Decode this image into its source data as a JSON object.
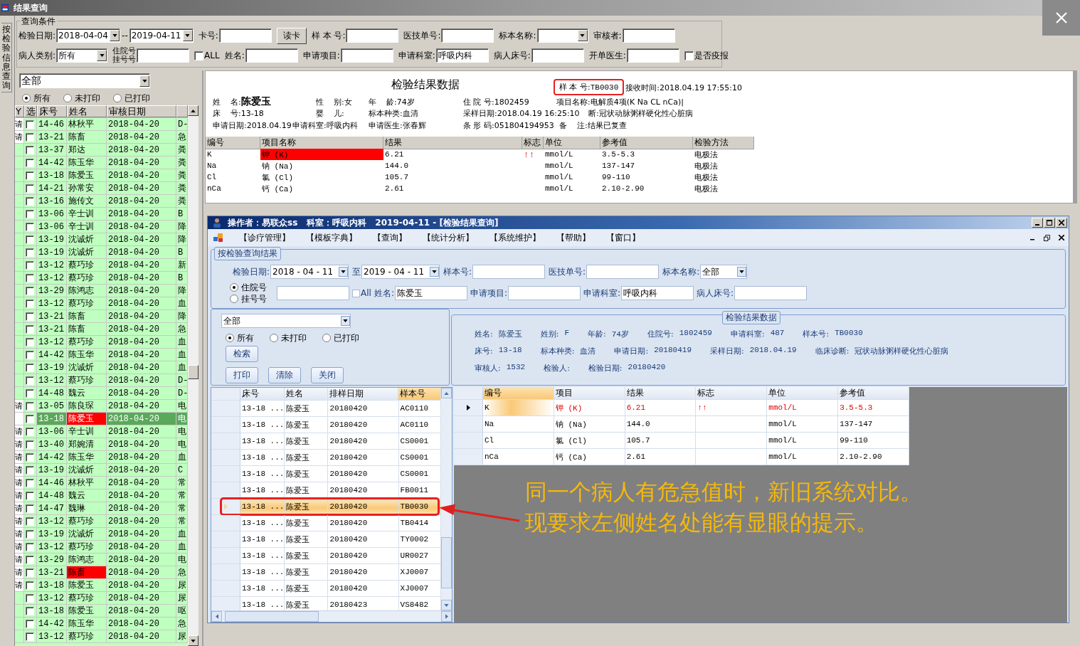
{
  "window": {
    "title": "结果查询"
  },
  "side_tab": {
    "label": "按检验信息查询"
  },
  "query": {
    "title": "查询条件",
    "lines": [
      {
        "fields": [
          {
            "kind": "date",
            "label": "检验日期:",
            "value": "2018-04-04"
          },
          {
            "kind": "separator",
            "text": "--"
          },
          {
            "kind": "date",
            "value": "2019-04-11"
          },
          {
            "kind": "text",
            "label": "卡号:"
          },
          {
            "kind": "button",
            "label": "读卡"
          },
          {
            "kind": "text",
            "label": "样 本 号:"
          },
          {
            "kind": "text",
            "label": "医技单号:"
          },
          {
            "kind": "combo",
            "label": "标本名称:"
          },
          {
            "kind": "text",
            "label": "审核者:"
          }
        ]
      },
      {
        "fields": [
          {
            "kind": "combo",
            "label": "病人类别:",
            "value": "所有"
          },
          {
            "kind": "stacked-text",
            "label_lines": [
              "住院号",
              "挂号号"
            ]
          },
          {
            "kind": "check",
            "label": "ALL",
            "checked": false
          },
          {
            "kind": "text",
            "label": "姓名:"
          },
          {
            "kind": "text",
            "label": "申请项目:"
          },
          {
            "kind": "text",
            "label": "申请科室:",
            "value": "呼吸内科"
          },
          {
            "kind": "text",
            "label": "病人床号:"
          },
          {
            "kind": "text",
            "label": "开单医生:"
          },
          {
            "kind": "check",
            "label": "是否疫报",
            "checked": false
          }
        ]
      }
    ]
  },
  "filter": {
    "category": "全部",
    "radios": [
      {
        "label": "所有",
        "selected": true
      },
      {
        "label": "未打印",
        "selected": false
      },
      {
        "label": "已打印",
        "selected": false
      }
    ]
  },
  "patients": {
    "columns": [
      "Y",
      "选",
      "床号",
      "姓名",
      "审核日期"
    ],
    "rows": [
      {
        "flag": "请",
        "checked": false,
        "bed": "14-46",
        "name": "林秋平",
        "date": "2018-04-20",
        "column_6": "D-",
        "selected": false,
        "alert": false
      },
      {
        "flag": "请",
        "checked": false,
        "bed": "13-21",
        "name": "陈畜",
        "date": "2018-04-20",
        "column_6": "急",
        "selected": false,
        "alert": false
      },
      {
        "checked": false,
        "bed": "13-37",
        "name": "郑达",
        "date": "2018-04-20",
        "column_6": "粪",
        "selected": false,
        "alert": false
      },
      {
        "checked": false,
        "bed": "14-42",
        "name": "陈玉华",
        "date": "2018-04-20",
        "column_6": "粪",
        "selected": false,
        "alert": false
      },
      {
        "checked": false,
        "bed": "13-18",
        "name": "陈爱玉",
        "date": "2018-04-20",
        "column_6": "粪",
        "selected": false,
        "alert": false
      },
      {
        "checked": false,
        "bed": "14-21",
        "name": "孙常安",
        "date": "2018-04-20",
        "column_6": "粪",
        "selected": false,
        "alert": false
      },
      {
        "checked": false,
        "bed": "13-16",
        "name": "施传文",
        "date": "2018-04-20",
        "column_6": "粪",
        "selected": false,
        "alert": false
      },
      {
        "checked": false,
        "bed": "13-06",
        "name": "辛士训",
        "date": "2018-04-20",
        "column_6": "B",
        "selected": false,
        "alert": false
      },
      {
        "checked": false,
        "bed": "13-06",
        "name": "辛士训",
        "date": "2018-04-20",
        "column_6": "降",
        "selected": false,
        "alert": false
      },
      {
        "checked": false,
        "bed": "13-19",
        "name": "沈诚炘",
        "date": "2018-04-20",
        "column_6": "降",
        "selected": false,
        "alert": false
      },
      {
        "checked": false,
        "bed": "13-19",
        "name": "沈诚炘",
        "date": "2018-04-20",
        "column_6": "B",
        "selected": false,
        "alert": false
      },
      {
        "checked": false,
        "bed": "13-12",
        "name": "蔡巧珍",
        "date": "2018-04-20",
        "column_6": "新",
        "selected": false,
        "alert": false
      },
      {
        "checked": false,
        "bed": "13-12",
        "name": "蔡巧珍",
        "date": "2018-04-20",
        "column_6": "B",
        "selected": false,
        "alert": false
      },
      {
        "checked": false,
        "bed": "13-29",
        "name": "陈鸿志",
        "date": "2018-04-20",
        "column_6": "降",
        "selected": false,
        "alert": false
      },
      {
        "checked": false,
        "bed": "13-12",
        "name": "蔡巧珍",
        "date": "2018-04-20",
        "column_6": "血",
        "selected": false,
        "alert": false
      },
      {
        "checked": false,
        "bed": "13-21",
        "name": "陈畜",
        "date": "2018-04-20",
        "column_6": "降",
        "selected": false,
        "alert": false
      },
      {
        "checked": false,
        "bed": "13-21",
        "name": "陈畜",
        "date": "2018-04-20",
        "column_6": "急",
        "selected": false,
        "alert": false
      },
      {
        "checked": false,
        "bed": "13-12",
        "name": "蔡巧珍",
        "date": "2018-04-20",
        "column_6": "血",
        "selected": false,
        "alert": false
      },
      {
        "checked": false,
        "bed": "14-42",
        "name": "陈玉华",
        "date": "2018-04-20",
        "column_6": "血",
        "selected": false,
        "alert": false
      },
      {
        "checked": false,
        "bed": "13-19",
        "name": "沈诚炘",
        "date": "2018-04-20",
        "column_6": "血",
        "selected": false,
        "alert": false
      },
      {
        "checked": false,
        "bed": "13-12",
        "name": "蔡巧珍",
        "date": "2018-04-20",
        "column_6": "D-",
        "selected": false,
        "alert": false
      },
      {
        "checked": false,
        "bed": "14-48",
        "name": "魏云",
        "date": "2018-04-20",
        "column_6": "D-",
        "selected": false,
        "alert": false
      },
      {
        "flag": "请",
        "checked": false,
        "bed": "13-05",
        "name": "陈良琛",
        "date": "2018-04-20",
        "column_6": "电",
        "selected": false,
        "alert": false
      },
      {
        "checked": false,
        "bed": "13-18",
        "name": "陈爱玉",
        "date": "2018-04-20",
        "column_6": "电",
        "selected": true,
        "alert": true
      },
      {
        "flag": "请",
        "checked": false,
        "bed": "13-06",
        "name": "辛士训",
        "date": "2018-04-20",
        "column_6": "电",
        "selected": false,
        "alert": false
      },
      {
        "flag": "请",
        "checked": false,
        "bed": "13-40",
        "name": "郑婉清",
        "date": "2018-04-20",
        "column_6": "电",
        "selected": false,
        "alert": false
      },
      {
        "flag": "请",
        "checked": false,
        "bed": "14-42",
        "name": "陈玉华",
        "date": "2018-04-20",
        "column_6": "血",
        "selected": false,
        "alert": false
      },
      {
        "flag": "请",
        "checked": false,
        "bed": "13-19",
        "name": "沈诚炘",
        "date": "2018-04-20",
        "column_6": "C",
        "selected": false,
        "alert": false
      },
      {
        "flag": "请",
        "checked": false,
        "bed": "14-46",
        "name": "林秋平",
        "date": "2018-04-20",
        "column_6": "常",
        "selected": false,
        "alert": false
      },
      {
        "flag": "请",
        "checked": false,
        "bed": "14-48",
        "name": "魏云",
        "date": "2018-04-20",
        "column_6": "常",
        "selected": false,
        "alert": false
      },
      {
        "flag": "请",
        "checked": false,
        "bed": "14-47",
        "name": "魏琳",
        "date": "2018-04-20",
        "column_6": "常",
        "selected": false,
        "alert": false
      },
      {
        "flag": "请",
        "checked": false,
        "bed": "13-12",
        "name": "蔡巧珍",
        "date": "2018-04-20",
        "column_6": "常",
        "selected": false,
        "alert": false
      },
      {
        "flag": "请",
        "checked": false,
        "bed": "13-19",
        "name": "沈诚炘",
        "date": "2018-04-20",
        "column_6": "血",
        "selected": false,
        "alert": false
      },
      {
        "flag": "请",
        "checked": false,
        "bed": "13-12",
        "name": "蔡巧珍",
        "date": "2018-04-20",
        "column_6": "血",
        "selected": false,
        "alert": false
      },
      {
        "flag": "请",
        "checked": false,
        "bed": "13-29",
        "name": "陈鸿志",
        "date": "2018-04-20",
        "column_6": "电",
        "selected": false,
        "alert": false
      },
      {
        "flag": "请",
        "checked": false,
        "bed": "13-21",
        "name": "陈畜",
        "date": "2018-04-20",
        "column_6": "急",
        "selected": false,
        "alert": true
      },
      {
        "flag": "请",
        "checked": false,
        "bed": "13-18",
        "name": "陈爱玉",
        "date": "2018-04-20",
        "column_6": "尿",
        "selected": false,
        "alert": false
      },
      {
        "checked": false,
        "bed": "13-12",
        "name": "蔡巧珍",
        "date": "2018-04-20",
        "column_6": "尿",
        "selected": false,
        "alert": false
      },
      {
        "checked": false,
        "bed": "13-18",
        "name": "陈爱玉",
        "date": "2018-04-20",
        "column_6": "呕",
        "selected": false,
        "alert": false
      },
      {
        "checked": false,
        "bed": "14-42",
        "name": "陈玉华",
        "date": "2018-04-20",
        "column_6": "急",
        "selected": false,
        "alert": false
      },
      {
        "checked": false,
        "bed": "13-12",
        "name": "蔡巧珍",
        "date": "2018-04-20",
        "column_6": "尿",
        "selected": false,
        "alert": false
      }
    ]
  },
  "report": {
    "title": "检验结果数据",
    "sample": {
      "label": "样 本 号:",
      "value": "TB0030",
      "circled": true
    },
    "received": "接收时间:2018.04.19 17:55:10",
    "lines": [
      [
        {
          "label": "姓    名:",
          "value": "陈爱玉",
          "bold": true
        },
        {
          "label": "性    别:",
          "value": "女"
        },
        {
          "label": "年    龄:",
          "value": "74岁"
        },
        {
          "label": "住 院 号:",
          "value": "1802459"
        },
        {
          "label": "项目名称:",
          "value": "电解质4项(K Na CL nCa)|"
        }
      ],
      [
        {
          "label": "床    号:",
          "value": "13-18"
        },
        {
          "label": "婴    儿:"
        },
        {
          "label": "标本种类:",
          "value": "血清"
        },
        {
          "label": "采样日期:",
          "value": "2018.04.19 16:25:10"
        },
        {
          "label": "断:",
          "value": "冠状动脉粥样硬化性心脏病"
        }
      ],
      [
        {
          "label": "申请日期:",
          "value": "2018.04.19"
        },
        {
          "label": "申请科室:",
          "value": "呼吸内科"
        },
        {
          "label": "申请医生:",
          "value": "张春辉"
        },
        {
          "label": "条 形 码:",
          "value": "051804194953"
        },
        {
          "label": "备    注:",
          "value": "结果已复查"
        }
      ]
    ],
    "columns": [
      "编号",
      "项目名称",
      "结果",
      "标志",
      "单位",
      "参考值",
      "检验方法"
    ],
    "rows": [
      {
        "code": "K",
        "name": "钾 (K)",
        "result": "6.21",
        "flag": "↑↑",
        "unit": "mmol/L",
        "range": "3.5-5.3",
        "method": "电极法",
        "alert": true
      },
      {
        "code": "Na",
        "name": "钠 (Na)",
        "result": "144.0",
        "unit": "mmol/L",
        "range": "137-147",
        "method": "电极法",
        "alert": false
      },
      {
        "code": "Cl",
        "name": "氯 (Cl)",
        "result": "105.7",
        "unit": "mmol/L",
        "range": "99-110",
        "method": "电极法",
        "alert": false
      },
      {
        "code": "nCa",
        "name": "钙 (Ca)",
        "result": "2.61",
        "unit": "mmol/L",
        "range": "2.10-2.90",
        "method": "电极法",
        "alert": false
      }
    ]
  },
  "inner_window": {
    "title": "操作者：易联众ss   科室：呼吸内科   2019-04-11 - [检验结果查询]",
    "menu": [
      "【诊疗管理】",
      "【模板字典】",
      "【查询】",
      "【统计分析】",
      "【系统维护】",
      "【帮助】",
      "【窗口】"
    ],
    "query": {
      "title": "按检验查询结果",
      "lines": [
        {
          "fields": [
            {
              "kind": "date",
              "label": "检验日期:",
              "value": "2018 - 04 - 11"
            },
            {
              "kind": "date",
              "label": "至",
              "value": "2019 - 04 - 11"
            },
            {
              "kind": "text",
              "label": "样本号:"
            },
            {
              "kind": "text",
              "label": "医技单号:"
            },
            {
              "kind": "combo",
              "label": "标本名称:",
              "value": "全部"
            }
          ]
        },
        {
          "fields": [
            {
              "kind": "radios",
              "options": [
                {
                  "label": "住院号",
                  "selected": true
                },
                {
                  "label": "挂号号",
                  "selected": false
                }
              ]
            },
            {
              "kind": "text"
            },
            {
              "kind": "check",
              "label": "All",
              "checked": false
            },
            {
              "kind": "text",
              "label": "姓名:",
              "value": "陈爱玉"
            },
            {
              "kind": "text",
              "label": "申请项目:"
            },
            {
              "kind": "text",
              "label": "申请科室:",
              "value": "呼吸内科"
            },
            {
              "kind": "text",
              "label": "病人床号:"
            }
          ]
        }
      ]
    },
    "filter": {
      "category": "全部",
      "radios": [
        {
          "label": "所有",
          "selected": true
        },
        {
          "label": "未打印",
          "selected": false
        },
        {
          "label": "已打印",
          "selected": false
        }
      ],
      "search": "检索",
      "actions": [
        "打印",
        "清除",
        "关闭"
      ]
    },
    "info": {
      "title": "检验结果数据",
      "lines": [
        [
          {
            "label": "姓名:",
            "value": "陈爱玉"
          },
          {
            "label": "姓别:",
            "value": "F"
          },
          {
            "label": "年龄:",
            "value": "74岁"
          },
          {
            "label": "住院号:",
            "value": "1802459"
          },
          {
            "label": "申请科室:",
            "value": "487"
          },
          {
            "label": "样本号:",
            "value": "TB0030"
          }
        ],
        [
          {
            "label": "床号:",
            "value": "13-18"
          },
          {
            "label": "标本种类:",
            "value": "血清"
          },
          {
            "label": "申请日期:",
            "value": "20180419"
          },
          {
            "label": "采样日期:",
            "value": "2018.04.19"
          },
          {
            "label": "临床诊断:",
            "value": "冠状动脉粥样硬化性心脏病"
          }
        ],
        [
          {
            "label": "审核人:",
            "value": "1532"
          },
          {
            "label": "检验人:"
          },
          {
            "label": "检验日期:",
            "value": "20180420"
          }
        ]
      ]
    },
    "samples": {
      "columns": [
        {
          "label": "床号",
          "sorted": false
        },
        {
          "label": "姓名",
          "sorted": false
        },
        {
          "label": "排样日期",
          "sorted": false
        },
        {
          "label": "样本号",
          "sorted": true
        }
      ],
      "rows": [
        {
          "bed": "13-18 ...",
          "name": "陈爱玉",
          "date": "20180420",
          "sample": "AC0110",
          "selected": false,
          "circled": false
        },
        {
          "bed": "13-18 ...",
          "name": "陈爱玉",
          "date": "20180420",
          "sample": "AC0110",
          "selected": false,
          "circled": false
        },
        {
          "bed": "13-18 ...",
          "name": "陈爱玉",
          "date": "20180420",
          "sample": "CS0001",
          "selected": false,
          "circled": false
        },
        {
          "bed": "13-18 ...",
          "name": "陈爱玉",
          "date": "20180420",
          "sample": "CS0001",
          "selected": false,
          "circled": false
        },
        {
          "bed": "13-18 ...",
          "name": "陈爱玉",
          "date": "20180420",
          "sample": "CS0001",
          "selected": false,
          "circled": false
        },
        {
          "bed": "13-18 ...",
          "name": "陈爱玉",
          "date": "20180420",
          "sample": "FB0011",
          "selected": false,
          "circled": false
        },
        {
          "bed": "13-18 ...",
          "name": "陈爱玉",
          "date": "20180420",
          "sample": "TB0030",
          "selected": true,
          "circled": true
        },
        {
          "bed": "13-18 ...",
          "name": "陈爱玉",
          "date": "20180420",
          "sample": "TB0414",
          "selected": false,
          "circled": false
        },
        {
          "bed": "13-18 ...",
          "name": "陈爱玉",
          "date": "20180420",
          "sample": "TY0002",
          "selected": false,
          "circled": false
        },
        {
          "bed": "13-18 ...",
          "name": "陈爱玉",
          "date": "20180420",
          "sample": "UR0027",
          "selected": false,
          "circled": false
        },
        {
          "bed": "13-18 ...",
          "name": "陈爱玉",
          "date": "20180420",
          "sample": "XJ0007",
          "selected": false,
          "circled": false
        },
        {
          "bed": "13-18 ...",
          "name": "陈爱玉",
          "date": "20180420",
          "sample": "XJ0007",
          "selected": false,
          "circled": false
        },
        {
          "bed": "13-18 ...",
          "name": "陈爱玉",
          "date": "20180423",
          "sample": "VS8482",
          "selected": false,
          "circled": false
        }
      ]
    },
    "items": {
      "columns": [
        {
          "label": "编号",
          "sorted": true
        },
        {
          "label": "项目",
          "sorted": false
        },
        {
          "label": "结果",
          "sorted": false
        },
        {
          "label": "标志",
          "sorted": false
        },
        {
          "label": "单位",
          "sorted": false
        },
        {
          "label": "参考值",
          "sorted": false
        }
      ],
      "rows": [
        {
          "code": "K",
          "name": "钾 (K)",
          "result": "6.21",
          "flag": "↑↑",
          "unit": "mmol/L",
          "range": "3.5-5.3",
          "selected": true,
          "alert": true
        },
        {
          "code": "Na",
          "name": "钠 (Na)",
          "result": "144.0",
          "unit": "mmol/L",
          "range": "137-147",
          "selected": false,
          "alert": false
        },
        {
          "code": "Cl",
          "name": "氯 (Cl)",
          "result": "105.7",
          "unit": "mmol/L",
          "range": "99-110",
          "selected": false,
          "alert": false
        },
        {
          "code": "nCa",
          "name": "钙 (Ca)",
          "result": "2.61",
          "unit": "mmol/L",
          "range": "2.10-2.90",
          "selected": false,
          "alert": false
        }
      ]
    }
  },
  "annotation": {
    "lines": [
      "同一个病人有危急值时，新旧系统对比。",
      "现要求左侧姓名处能有显眼的提示。"
    ]
  }
}
